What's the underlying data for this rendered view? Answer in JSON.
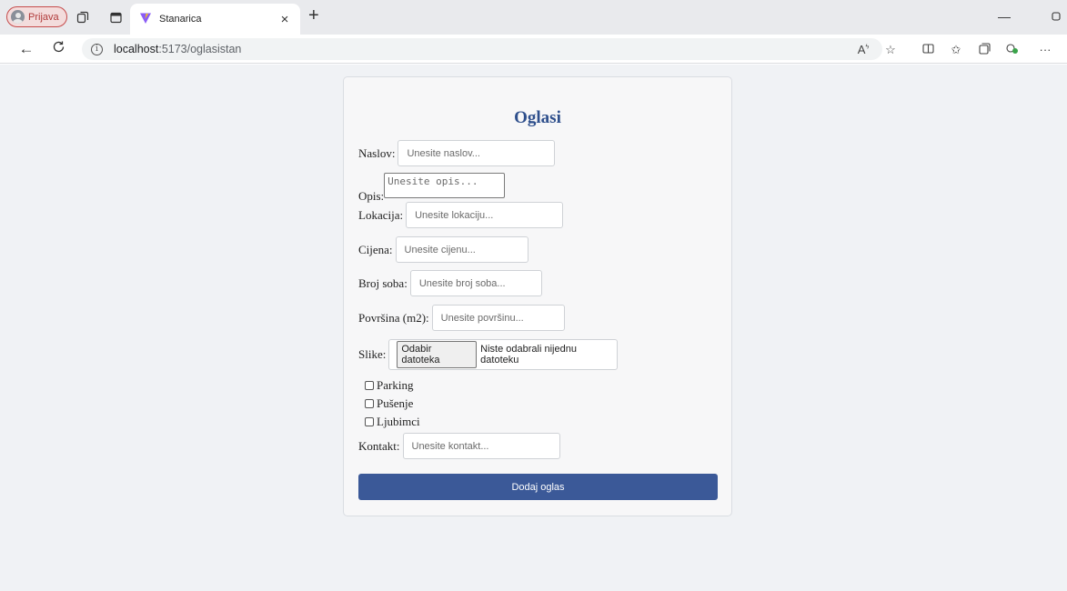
{
  "browser": {
    "profile_label": "Prijava",
    "tab_title": "Stanarica",
    "url_host": "localhost",
    "url_path": ":5173/oglasistan",
    "colors": {
      "profile_accent": "#c64b4b",
      "logo_purple": "#8b5cf6",
      "logo_yellow": "#f5c518"
    }
  },
  "form": {
    "title": "Oglasi",
    "fields": {
      "naslov": {
        "label": "Naslov:",
        "placeholder": "Unesite naslov..."
      },
      "opis": {
        "label": "Opis:",
        "placeholder": "Unesite opis..."
      },
      "lokacija": {
        "label": "Lokacija:",
        "placeholder": "Unesite lokaciju..."
      },
      "cijena": {
        "label": "Cijena:",
        "placeholder": "Unesite cijenu..."
      },
      "broj_soba": {
        "label": "Broj soba:",
        "placeholder": "Unesite broj soba..."
      },
      "povrsina": {
        "label": "Površina (m2):",
        "placeholder": "Unesite površinu..."
      },
      "slike": {
        "label": "Slike:",
        "button_label": "Odabir datoteka",
        "status": "Niste odabrali nijednu datoteku"
      },
      "kontakt": {
        "label": "Kontakt:",
        "placeholder": "Unesite kontakt..."
      }
    },
    "checkboxes": [
      {
        "label": "Parking",
        "checked": false
      },
      {
        "label": "Pušenje",
        "checked": false
      },
      {
        "label": "Ljubimci",
        "checked": false
      }
    ],
    "submit_label": "Dodaj oglas",
    "colors": {
      "title": "#2e4f8c",
      "submit_bg": "#3b5998"
    }
  }
}
